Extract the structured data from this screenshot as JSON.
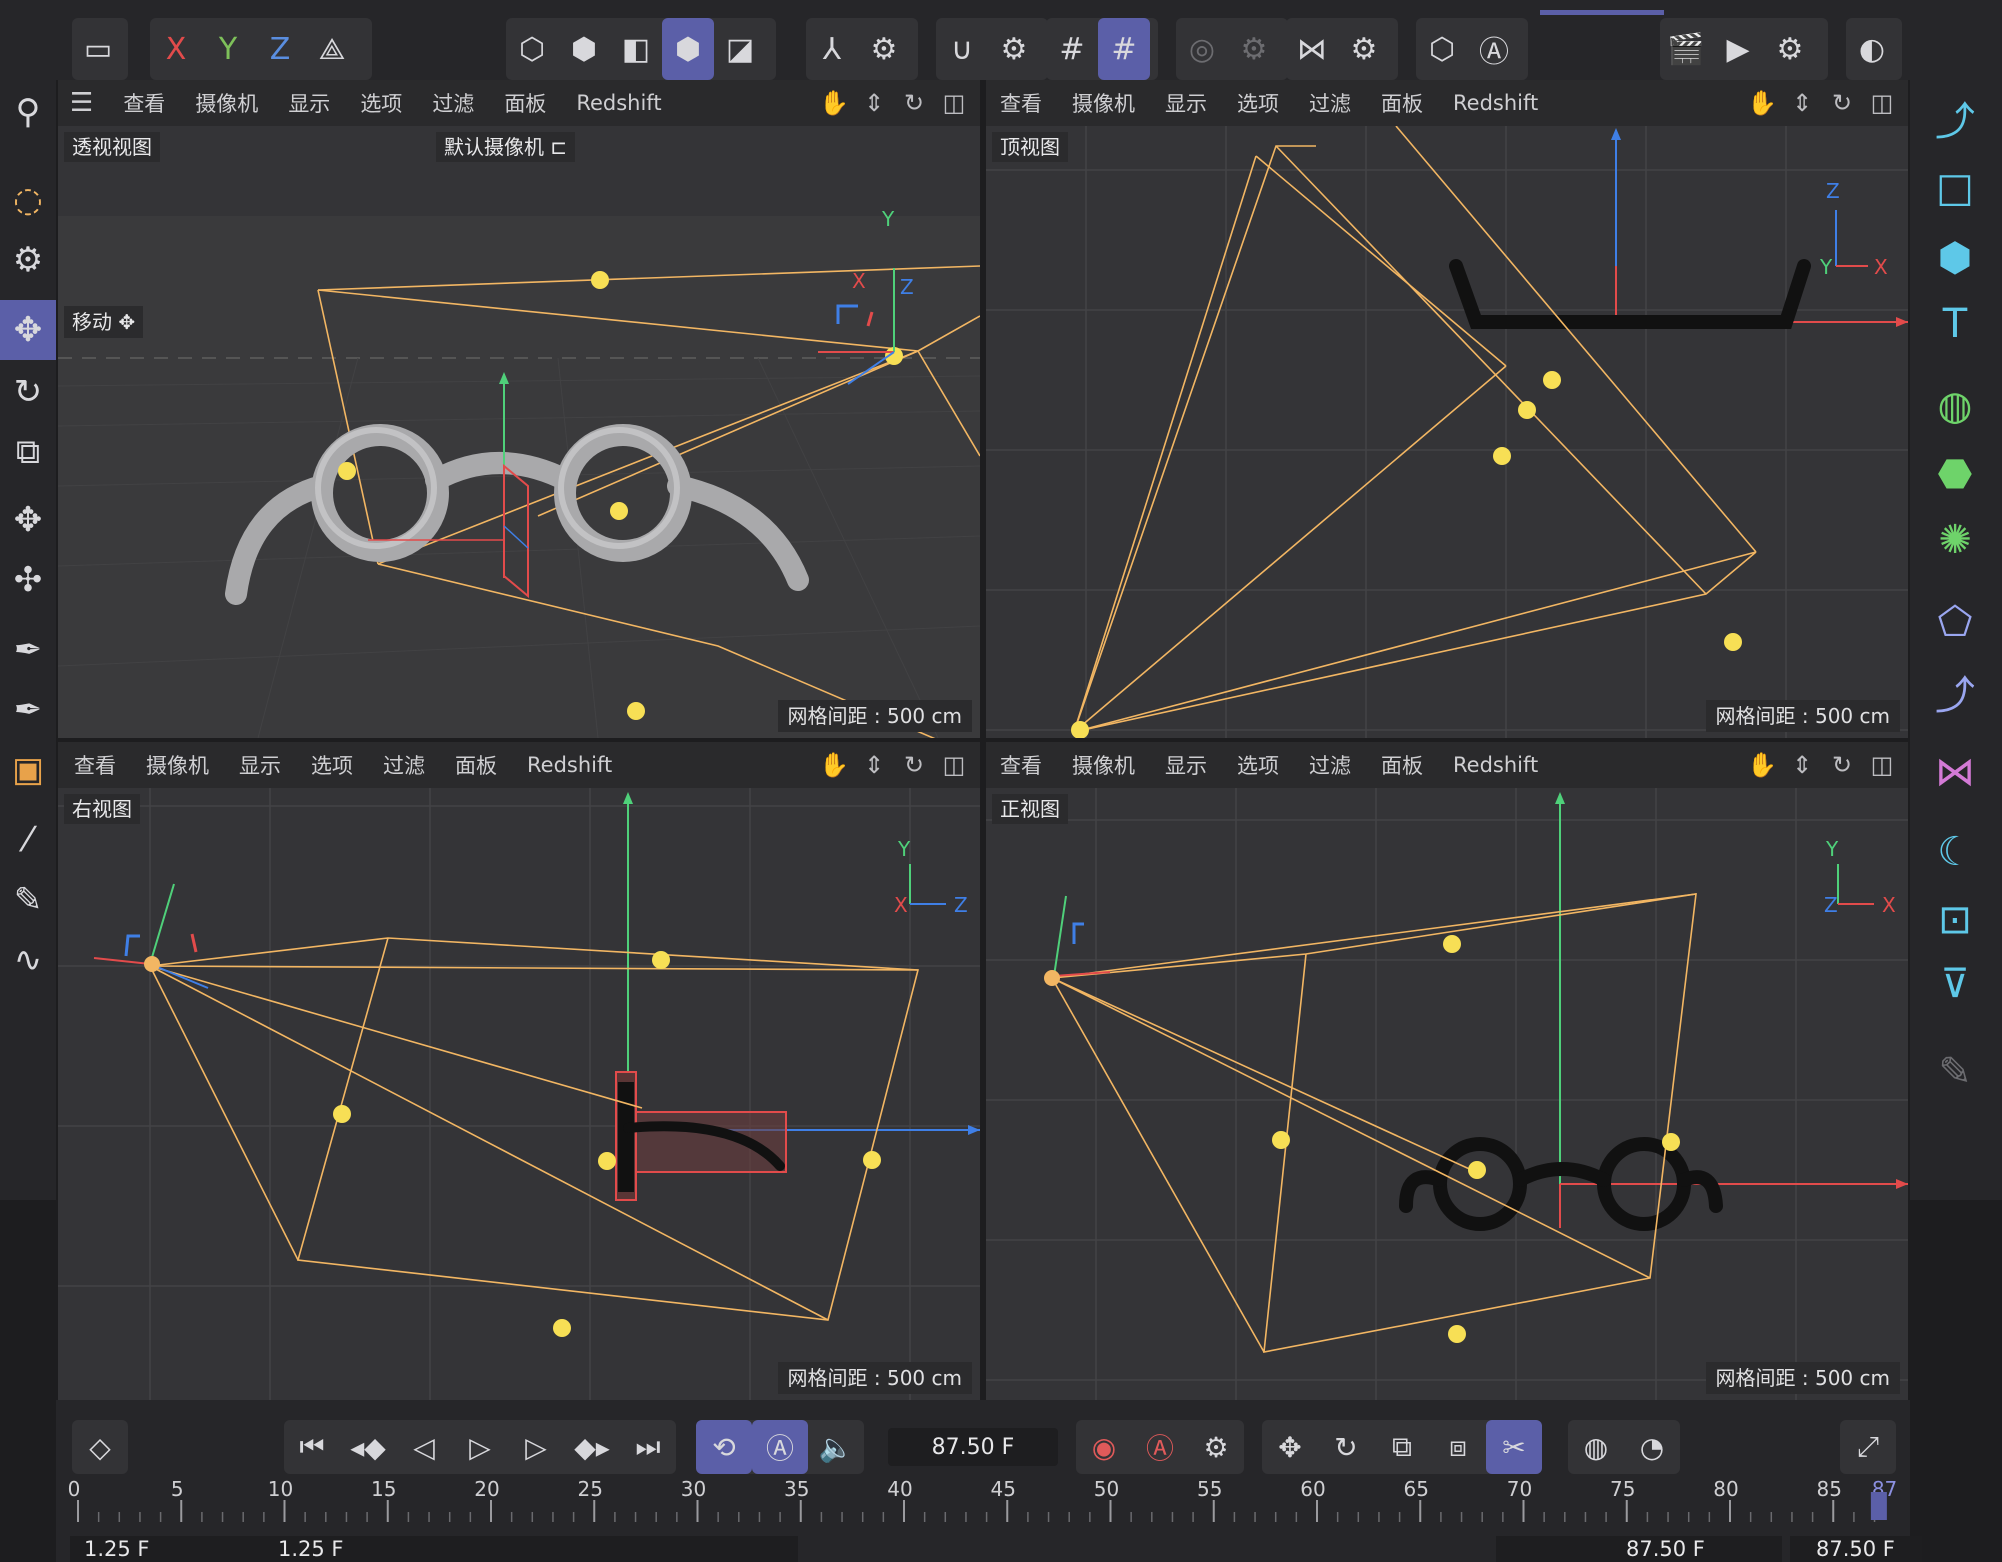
{
  "top_toolbar": {
    "axis_labels": [
      "X",
      "Y",
      "Z"
    ],
    "icons": [
      "archive-icon",
      "x-axis-lock",
      "y-axis-lock",
      "z-axis-lock",
      "world-coordinates-icon",
      "polygon-mode-icon",
      "edge-mode-icon",
      "face-mode-icon",
      "object-mode-icon",
      "texture-mode-icon",
      "axis-mode-icon",
      "gear-icon",
      "snap-magnet-icon",
      "gear-icon",
      "grid-snap-icon",
      "workplane-snap-icon",
      "soft-selection-icon",
      "gear-icon",
      "symmetry-icon",
      "gear-icon",
      "isolate-icon",
      "auto-key-icon",
      "render-region-icon",
      "render-view-icon",
      "render-settings-icon",
      "cinema-logo-icon"
    ]
  },
  "viewports": [
    {
      "id": "perspective",
      "menu": [
        "查看",
        "摄像机",
        "显示",
        "选项",
        "过滤",
        "面板",
        "Redshift"
      ],
      "label": "透视视图",
      "camera_label": "默认摄像机",
      "tool_hint": "移动",
      "grid_spacing": "网格间距 : 500 cm",
      "axis": {
        "y": "Y",
        "x": "X",
        "z": "Z"
      }
    },
    {
      "id": "top",
      "menu": [
        "查看",
        "摄像机",
        "显示",
        "选项",
        "过滤",
        "面板",
        "Redshift"
      ],
      "label": "顶视图",
      "grid_spacing": "网格间距 : 500 cm",
      "axis": {
        "z": "Z",
        "y": "Y",
        "x": "X"
      }
    },
    {
      "id": "right",
      "menu": [
        "查看",
        "摄像机",
        "显示",
        "选项",
        "过滤",
        "面板",
        "Redshift"
      ],
      "label": "右视图",
      "grid_spacing": "网格间距 : 500 cm",
      "axis": {
        "y": "Y",
        "x": "X",
        "z": "Z"
      }
    },
    {
      "id": "front",
      "menu": [
        "查看",
        "摄像机",
        "显示",
        "选项",
        "过滤",
        "面板",
        "Redshift"
      ],
      "label": "正视图",
      "grid_spacing": "网格间距 : 500 cm",
      "axis": {
        "y": "Y",
        "z": "Z",
        "x": "X"
      }
    }
  ],
  "timeline": {
    "current_frame": "87.50 F",
    "ruler_labels": [
      "0",
      "5",
      "10",
      "15",
      "20",
      "25",
      "30",
      "35",
      "40",
      "45",
      "50",
      "55",
      "60",
      "65",
      "70",
      "75",
      "80",
      "85",
      "87"
    ],
    "range_start": "1.25 F",
    "range_start_2": "1.25 F",
    "range_end": "87.50 F",
    "range_end_2": "87.50 F",
    "playhead_frame": 87.5,
    "frame_max": 87.5
  },
  "colors": {
    "accent": "#5b5fa8",
    "camera_wire": "#f2b663",
    "handle": "#f7df55",
    "axis_x": "#e24b4b",
    "axis_y": "#4fd07a",
    "axis_z": "#3f7fe6"
  }
}
